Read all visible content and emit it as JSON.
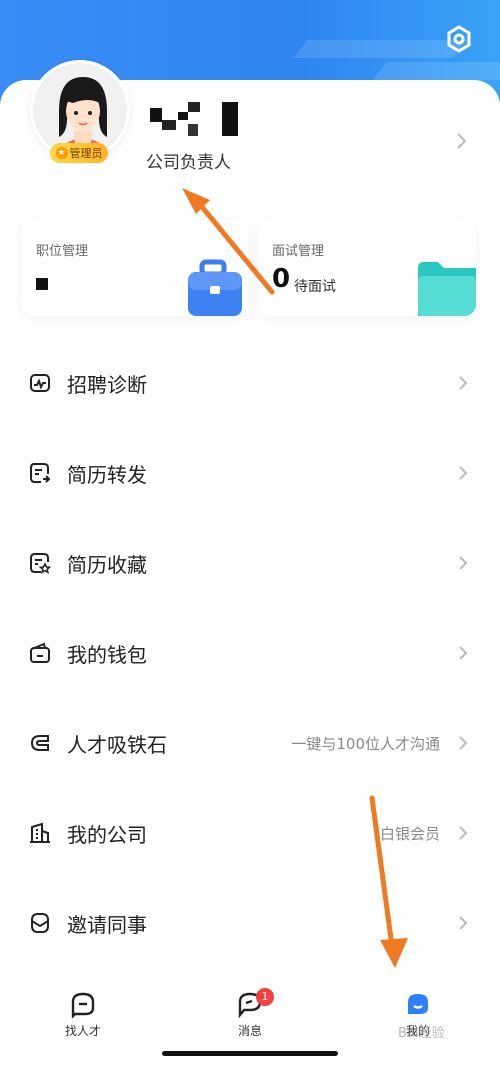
{
  "profile": {
    "role": "公司负责人",
    "badge": "管理员"
  },
  "stats": [
    {
      "title": "职位管理",
      "value": ""
    },
    {
      "title": "面试管理",
      "value": "0",
      "sub": "待面试"
    }
  ],
  "menu": [
    {
      "label": "招聘诊断",
      "icon": "pulse-chart-icon",
      "hint": ""
    },
    {
      "label": "简历转发",
      "icon": "resume-forward-icon",
      "hint": ""
    },
    {
      "label": "简历收藏",
      "icon": "resume-star-icon",
      "hint": ""
    },
    {
      "label": "我的钱包",
      "icon": "wallet-icon",
      "hint": ""
    },
    {
      "label": "人才吸铁石",
      "icon": "magnet-icon",
      "hint": "一键与100位人才沟通"
    },
    {
      "label": "我的公司",
      "icon": "company-building-icon",
      "hint": "白银会员"
    },
    {
      "label": "邀请同事",
      "icon": "invite-icon",
      "hint": ""
    }
  ],
  "tabbar": {
    "items": [
      {
        "label": "找人才",
        "icon": "find-talent-icon"
      },
      {
        "label": "消息",
        "icon": "message-icon",
        "badge": "1"
      },
      {
        "label": "我的",
        "icon": "profile-icon",
        "active": true
      }
    ]
  },
  "watermark": "Bai经验",
  "colors": {
    "header": "#2e86f0",
    "accent": "#2f7ff6",
    "annotation_arrow": "#f07a22"
  }
}
